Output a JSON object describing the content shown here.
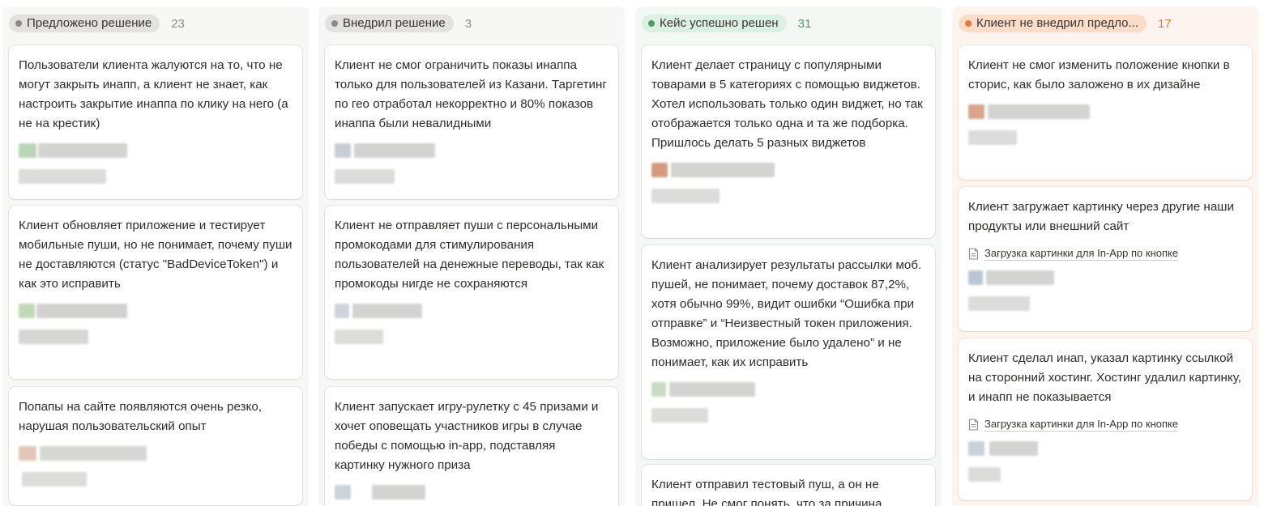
{
  "columns": [
    {
      "status": "Предложено решение",
      "count": "23",
      "dot_color": "#8b8a87",
      "pill_bg": "#e3e2e0",
      "count_color": "#8b8a87",
      "cards": [
        {
          "text": "Пользователи клиента жалуются на то, что не могут закрыть инапп, а клиент не знает, как настроить закрытие инаппа по клику на него (а не на крестик)"
        },
        {
          "text": "Клиент обновляет приложение и тестирует мобильные пуши, но не понимает, почему пуши не доставляются (статус \"BadDeviceToken\") и как это исправить"
        },
        {
          "text": "Попапы на сайте появляются очень резко, нарушая пользовательский опыт"
        }
      ]
    },
    {
      "status": "Внедрил решение",
      "count": "3",
      "dot_color": "#8b8a87",
      "pill_bg": "#e3e2e0",
      "count_color": "#8b8a87",
      "cards": [
        {
          "text": "Клиент не смог ограничить показы инаппа только для пользователей из Казани. Таргетинг по гео отработал некорректно и 80% показов инаппа были невалидными"
        },
        {
          "text": "Клиент не отправляет пуши с персональными промокодами для стимулирования пользователей на денежные переводы, так как промокоды нигде не сохраняются"
        },
        {
          "text": "Клиент запускает игру-рулетку с 45 призами и хочет оповещать участников игры в случае победы с помощью in-app, подставляя картинку нужного приза"
        }
      ]
    },
    {
      "status": "Кейс успешно решен",
      "count": "31",
      "dot_color": "#4d9b6a",
      "pill_bg": "#dcefe3",
      "count_color": "#4d9b6a",
      "cards": [
        {
          "text": "Клиент делает страницу с популярными товарами в 5 категориях с помощью виджетов. Хотел использовать только один виджет, но так отображается только одна и та же подборка. Пришлось делать 5 разных виджетов"
        },
        {
          "text": "Клиент анализирует результаты рассылки моб. пушей,  не понимает, почему доставок 87,2%, хотя обычно 99%,  видит ошибки “Ошибка при отправке” и “Неизвестный токен приложения. Возможно, приложение было удалено” и не понимает, как их исправить"
        },
        {
          "text": "Клиент отправил тестовый пуш, а он не пришел. Не смог понять, что за причина"
        }
      ]
    },
    {
      "status": "Клиент не внедрил предло...",
      "count": "17",
      "dot_color": "#e07b3c",
      "pill_bg": "#fbdcc8",
      "count_color": "#e07b3c",
      "cards": [
        {
          "text": "Клиент не смог изменить положение кнопки в сторис, как было заложено в их дизайне"
        },
        {
          "text": "Клиент загружает картинку через другие наши продукты или внешний сайт",
          "link": "Загрузка картинки для In-App по кнопке"
        },
        {
          "text": "Клиент сделал инап, указал картинку ссылкой на сторонний хостинг. Хостинг удалил картинку, и инапп не показывается",
          "link": "Загрузка картинки для In-App по кнопке"
        }
      ]
    }
  ],
  "link_icon": "document-icon"
}
